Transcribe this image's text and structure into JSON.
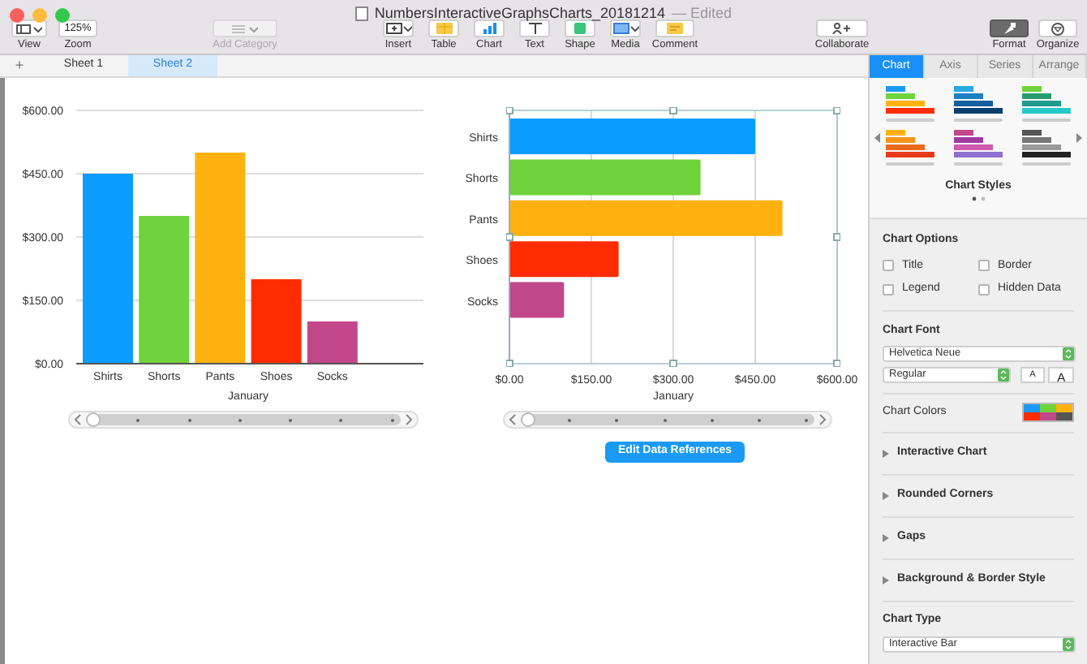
{
  "window": {
    "title": "NumbersInteractiveGraphsCharts_20181214",
    "status": "— Edited"
  },
  "toolbar": {
    "view": {
      "label": "View"
    },
    "zoom": {
      "value": "125%",
      "label": "Zoom"
    },
    "add_category": {
      "label": "Add Category",
      "disabled": true
    },
    "insert": [
      {
        "kind": "insert",
        "label": "Insert"
      },
      {
        "kind": "table",
        "label": "Table"
      },
      {
        "kind": "chart",
        "label": "Chart"
      },
      {
        "kind": "text",
        "label": "Text"
      },
      {
        "kind": "shape",
        "label": "Shape"
      },
      {
        "kind": "media",
        "label": "Media"
      },
      {
        "kind": "comment",
        "label": "Comment"
      }
    ],
    "collaborate": {
      "label": "Collaborate"
    },
    "right": [
      {
        "kind": "format",
        "label": "Format",
        "selected": true
      },
      {
        "kind": "organize",
        "label": "Organize",
        "selected": false
      }
    ]
  },
  "sheets": {
    "add": "+",
    "tabs": [
      {
        "label": "Sheet 1",
        "selected": false
      },
      {
        "label": "Sheet 2",
        "selected": true
      }
    ]
  },
  "charts": [
    {
      "selected": false,
      "chart_data": {
        "type": "bar",
        "orientation": "vertical",
        "xlabel": "January",
        "categories": [
          "Shirts",
          "Shorts",
          "Pants",
          "Shoes",
          "Socks"
        ],
        "colors": [
          "#0a9dff",
          "#6fd33b",
          "#ffb20f",
          "#ff2c00",
          "#c2478b"
        ],
        "series": [
          {
            "values": [
              450,
              350,
              500,
              200,
              100
            ]
          }
        ],
        "grid": true,
        "ylim": [
          0,
          600
        ],
        "yticks": [
          {
            "value": 0,
            "label": "$0.00"
          },
          {
            "value": 150,
            "label": "$150.00"
          },
          {
            "value": 300,
            "label": "$300.00"
          },
          {
            "value": 450,
            "label": "$450.00"
          },
          {
            "value": 600,
            "label": "$600.00"
          }
        ]
      },
      "slider": {
        "level": 0
      }
    },
    {
      "selected": true,
      "chart_data": {
        "type": "bar",
        "orientation": "horizontal",
        "xlabel": "January",
        "categories": [
          "Shirts",
          "Shorts",
          "Pants",
          "Shoes",
          "Socks"
        ],
        "colors": [
          "#0a9dff",
          "#6fd33b",
          "#ffb20f",
          "#ff2c00",
          "#c2478b"
        ],
        "series": [
          {
            "values": [
              450,
              350,
              500,
              200,
              100
            ]
          }
        ],
        "grid": true,
        "xlim": [
          0,
          600
        ],
        "xticks": [
          {
            "value": 0,
            "label": "$0.00"
          },
          {
            "value": 150,
            "label": "$150.00"
          },
          {
            "value": 300,
            "label": "$300.00"
          },
          {
            "value": 450,
            "label": "$450.00"
          },
          {
            "value": 600,
            "label": "$600.00"
          }
        ]
      },
      "slider": {
        "level": 0
      },
      "button": "Edit Data References"
    }
  ],
  "sidebar": {
    "tabs": [
      {
        "label": "Chart",
        "selected": true
      },
      {
        "label": "Axis",
        "selected": false
      },
      {
        "label": "Series",
        "selected": false
      },
      {
        "label": "Arrange",
        "selected": false
      }
    ],
    "styles_label": "Chart Styles",
    "chart_options": {
      "title": "Chart Options",
      "options": [
        {
          "label": "Title",
          "checked": false
        },
        {
          "label": "Border",
          "checked": false
        },
        {
          "label": "Legend",
          "checked": false
        },
        {
          "label": "Hidden Data",
          "checked": false
        }
      ]
    },
    "chart_font": {
      "title": "Chart Font",
      "family": "Helvetica Neue",
      "style": "Regular",
      "smaller": "A",
      "larger": "A"
    },
    "chart_colors": {
      "label": "Chart Colors"
    },
    "sections": [
      {
        "label": "Interactive Chart",
        "expanded": false
      },
      {
        "label": "Rounded Corners",
        "expanded": false
      },
      {
        "label": "Gaps",
        "expanded": false
      },
      {
        "label": "Background & Border Style",
        "expanded": false
      }
    ],
    "chart_type": {
      "title": "Chart Type",
      "value": "Interactive Bar"
    }
  }
}
